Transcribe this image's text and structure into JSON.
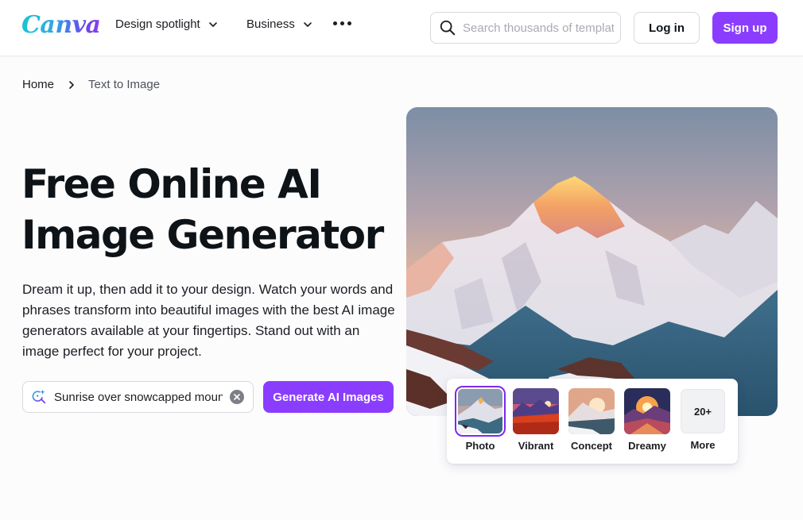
{
  "header": {
    "logo": "Canva",
    "nav": [
      {
        "label": "Design spotlight",
        "has_dropdown": true
      },
      {
        "label": "Business",
        "has_dropdown": true
      }
    ],
    "more_icon": "more-horizontal-icon",
    "search": {
      "placeholder": "Search thousands of templates",
      "value": ""
    },
    "login_label": "Log in",
    "signup_label": "Sign up"
  },
  "breadcrumb": {
    "items": [
      "Home",
      "Text to Image"
    ]
  },
  "hero": {
    "title": "Free Online AI Image Generator",
    "description": "Dream it up, then add it to your design. Watch your words and phrases transform into beautiful images with the best AI image generators available at your fingertips. Stand out with an image perfect for your project.",
    "prompt": {
      "value": "Sunrise over snowcapped mountains"
    },
    "generate_label": "Generate AI Images",
    "image_alt": "Snowcapped mountain at sunrise"
  },
  "styles": {
    "selected": "Photo",
    "items": [
      {
        "label": "Photo"
      },
      {
        "label": "Vibrant"
      },
      {
        "label": "Concept"
      },
      {
        "label": "Dreamy"
      }
    ],
    "more": {
      "count_label": "20+",
      "label": "More"
    }
  },
  "colors": {
    "accent": "#8b3dff",
    "selected_outline": "#7d2ae8"
  }
}
